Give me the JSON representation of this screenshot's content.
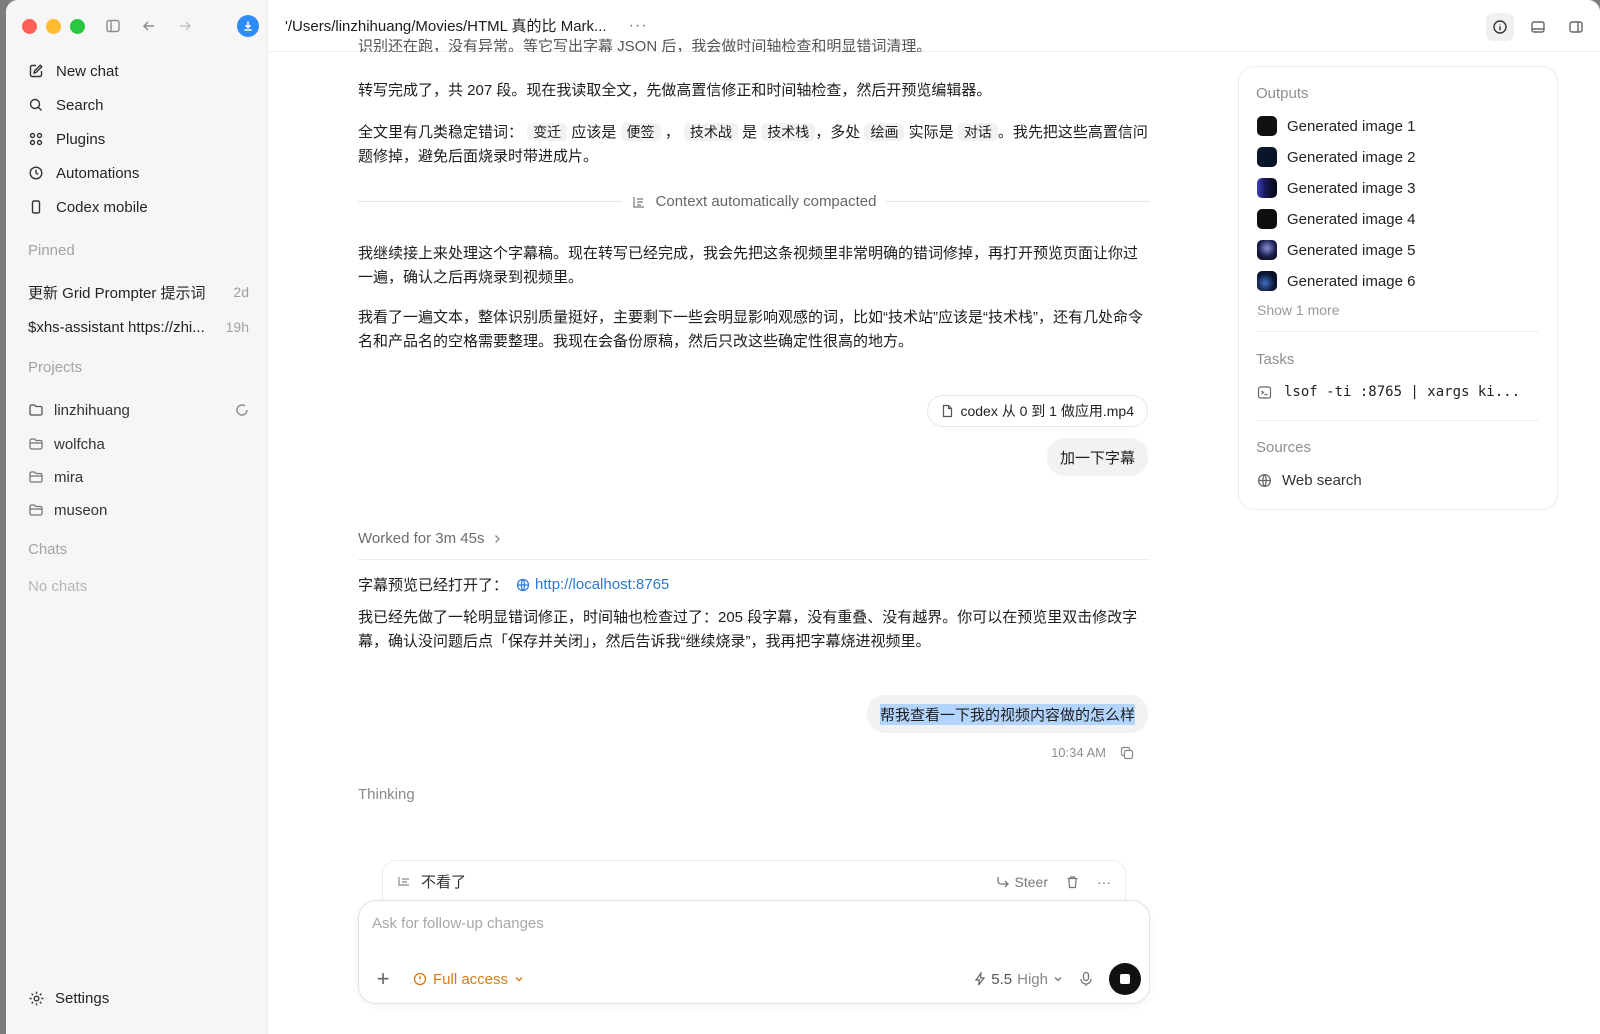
{
  "header": {
    "path": "'/Users/linzhihuang/Movies/HTML 真的比 Mark...",
    "more": "···"
  },
  "sidebar": {
    "nav": [
      {
        "label": "New chat",
        "icon": "edit-icon"
      },
      {
        "label": "Search",
        "icon": "search-icon"
      },
      {
        "label": "Plugins",
        "icon": "grid-icon"
      },
      {
        "label": "Automations",
        "icon": "clock-icon"
      },
      {
        "label": "Codex mobile",
        "icon": "phone-icon"
      }
    ],
    "pinned_title": "Pinned",
    "pinned": [
      {
        "title": "更新 Grid Prompter 提示词",
        "time": "2d"
      },
      {
        "title": "$xhs-assistant https://zhi...",
        "time": "19h"
      }
    ],
    "projects_title": "Projects",
    "projects": [
      "linzhihuang",
      "wolfcha",
      "mira",
      "museon"
    ],
    "chats_title": "Chats",
    "no_chats": "No chats",
    "settings": "Settings"
  },
  "conversation": {
    "top_cut_text": "识别还在跑，没有异常。等它写出字幕 JSON 后，我会做时间轴检查和明显错词清理。",
    "p1": "转写完成了，共 207 段。现在我读取全文，先做高置信修正和时间轴检查，然后开预览编辑器。",
    "p2": {
      "t1": "全文里有几类稳定错词：",
      "c1": "变迁",
      "t2": "应该是",
      "c2": "便签",
      "t3": "，",
      "c3": "技术战",
      "t4": "是",
      "c4": "技术栈",
      "t5": "，多处",
      "c5": "绘画",
      "t6": "实际是",
      "c6": "对话",
      "t7": "。我先把这些高置信问题修掉，避免后面烧录时带进成片。"
    },
    "compacted": "Context automatically compacted",
    "p3": "我继续接上来处理这个字幕稿。现在转写已经完成，我会先把这条视频里非常明确的错词修掉，再打开预览页面让你过一遍，确认之后再烧录到视频里。",
    "p4": "我看了一遍文本，整体识别质量挺好，主要剩下一些会明显影响观感的词，比如“技术站”应该是“技术栈”，还有几处命令名和产品名的空格需要整理。我现在会备份原稿，然后只改这些确定性很高的地方。",
    "file_chip": "codex 从 0 到 1 做应用.mp4",
    "user_msg1": "加一下字幕",
    "worked": "Worked for 3m 45s",
    "preview_label": "字幕预览已经打开了：",
    "preview_link": "http://localhost:8765",
    "p5": "我已经先做了一轮明显错词修正，时间轴也检查过了：205 段字幕，没有重叠、没有越界。你可以在预览里双击修改字幕，确认没问题后点「保存并关闭」，然后告诉我“继续烧录”，我再把字幕烧进视频里。",
    "user_msg2": "帮我查看一下我的视频内容做的怎么样",
    "msg_time": "10:34 AM",
    "thinking": "Thinking"
  },
  "composer": {
    "queued_text": "不看了",
    "steer": "Steer",
    "placeholder": "Ask for follow-up changes",
    "access": "Full access",
    "model": "5.5",
    "level": "High"
  },
  "panel": {
    "outputs_title": "Outputs",
    "outputs": [
      "Generated image 1",
      "Generated image 2",
      "Generated image 3",
      "Generated image 4",
      "Generated image 5",
      "Generated image 6"
    ],
    "show_more": "Show 1 more",
    "tasks_title": "Tasks",
    "task": "lsof -ti :8765 | xargs ki...",
    "sources_title": "Sources",
    "source": "Web search"
  },
  "colors": {
    "accent_blue": "#2f8cf5",
    "link": "#2a78d6",
    "access_orange": "#d97a1a",
    "selection": "#b3d4fc"
  }
}
